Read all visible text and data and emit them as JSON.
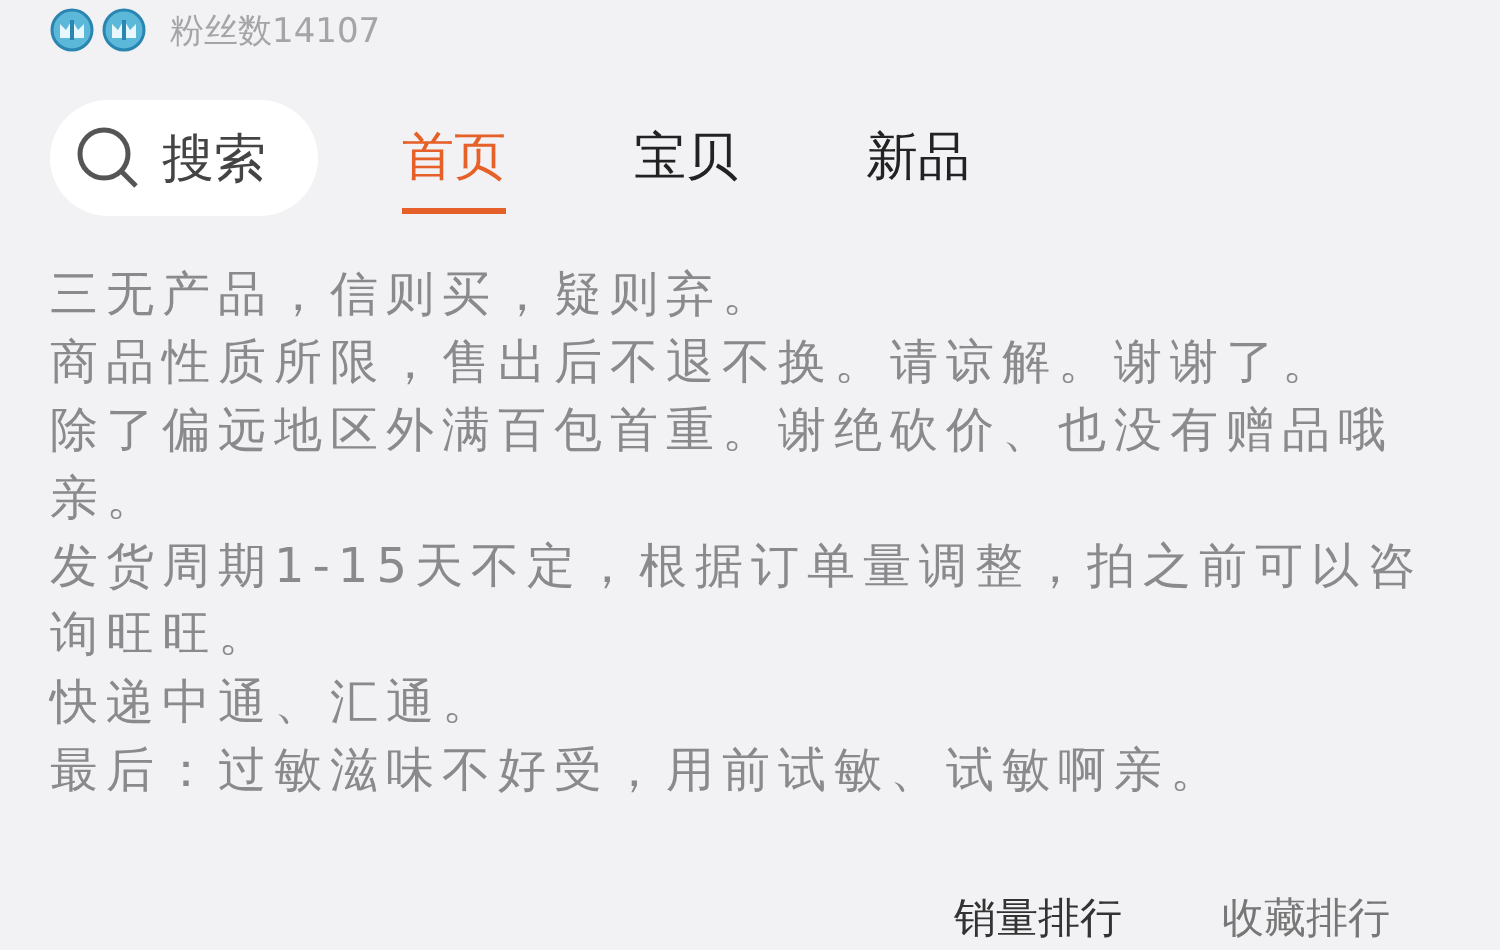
{
  "header": {
    "badges": [
      {
        "kind": "crown"
      },
      {
        "kind": "crown"
      }
    ],
    "fans": "粉丝数14107"
  },
  "search": {
    "label": "搜索"
  },
  "tabs": [
    {
      "label": "首页",
      "selected": true
    },
    {
      "label": "宝贝",
      "selected": false
    },
    {
      "label": "新品",
      "selected": false
    }
  ],
  "notice": [
    "三无产品，信则买，疑则弃。",
    "商品性质所限，售出后不退不换。请谅解。谢谢了。",
    "除了偏远地区外满百包首重。谢绝砍价、也没有赠品哦亲。",
    "发货周期1-15天不定，根据订单量调整，拍之前可以咨询旺旺。",
    "快递中通、汇通。",
    "最后：过敏滋味不好受，用前试敏、试敏啊亲。"
  ],
  "ranking_tabs": [
    {
      "label": "销量排行",
      "selected": true
    },
    {
      "label": "收藏排行",
      "selected": false
    }
  ]
}
